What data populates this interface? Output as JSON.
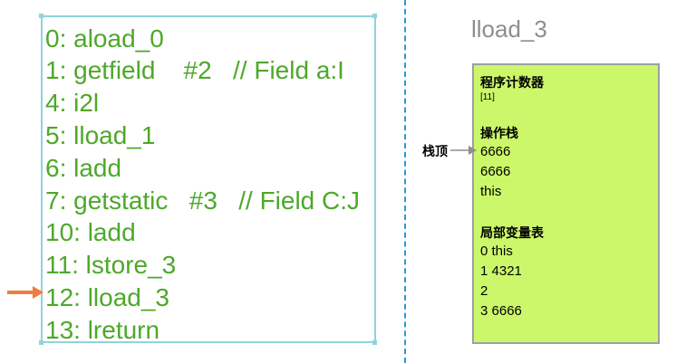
{
  "code": {
    "lines": [
      "0: aload_0",
      "1: getfield    #2   // Field a:I",
      "4: i2l",
      "5: lload_1",
      "6: ladd",
      "7: getstatic   #3   // Field C:J",
      "10: ladd",
      "11: lstore_3",
      "12: lload_3",
      "13: lreturn"
    ],
    "current_index": 8,
    "text_color": "#4ea82a",
    "pointer_color": "#f07b3f"
  },
  "title": "lload_3",
  "frame": {
    "pc_heading": "程序计数器",
    "pc_value": "[11]",
    "stack_heading": "操作栈",
    "stack_items": [
      "6666",
      "6666",
      "this"
    ],
    "locals_heading": "局部变量表",
    "locals": [
      "0 this",
      "1 4321",
      "2",
      "3 6666"
    ],
    "background": "#ccf76a"
  },
  "stack_top_label": "栈顶"
}
